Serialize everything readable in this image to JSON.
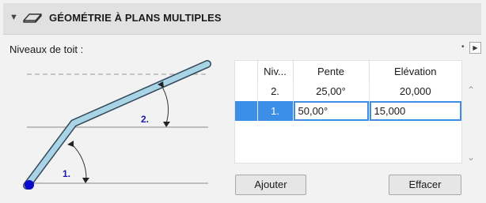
{
  "panel": {
    "title": "GÉOMÉTRIE À PLANS MULTIPLES",
    "collapse_icon": "triangle-down-icon",
    "roof_icon": "roof-icon"
  },
  "section": {
    "label": "Niveaux de toit :",
    "bullet": "•",
    "arrow": "▶"
  },
  "diagram": {
    "label_1": "1.",
    "label_2": "2.",
    "colors": {
      "roof": "#a8d4e6",
      "outline": "#33475b",
      "labels": "#1a1aa6",
      "dot": "#0a0acc"
    }
  },
  "table": {
    "columns": [
      "",
      "Niv...",
      "Pente",
      "Elévation"
    ],
    "rows": [
      {
        "niveau": "2.",
        "pente": "25,00°",
        "elevation": "20,000",
        "selected": false
      },
      {
        "niveau": "1.",
        "pente": "50,00°",
        "elevation": "15,000",
        "selected": true
      }
    ],
    "scroll_up": "⌃",
    "scroll_down": "⌄"
  },
  "buttons": {
    "add": "Ajouter",
    "delete": "Effacer"
  },
  "colors": {
    "selection": "#3d8ee6",
    "header_bg": "#e1e1e1",
    "panel_bg": "#f2f2f2"
  }
}
